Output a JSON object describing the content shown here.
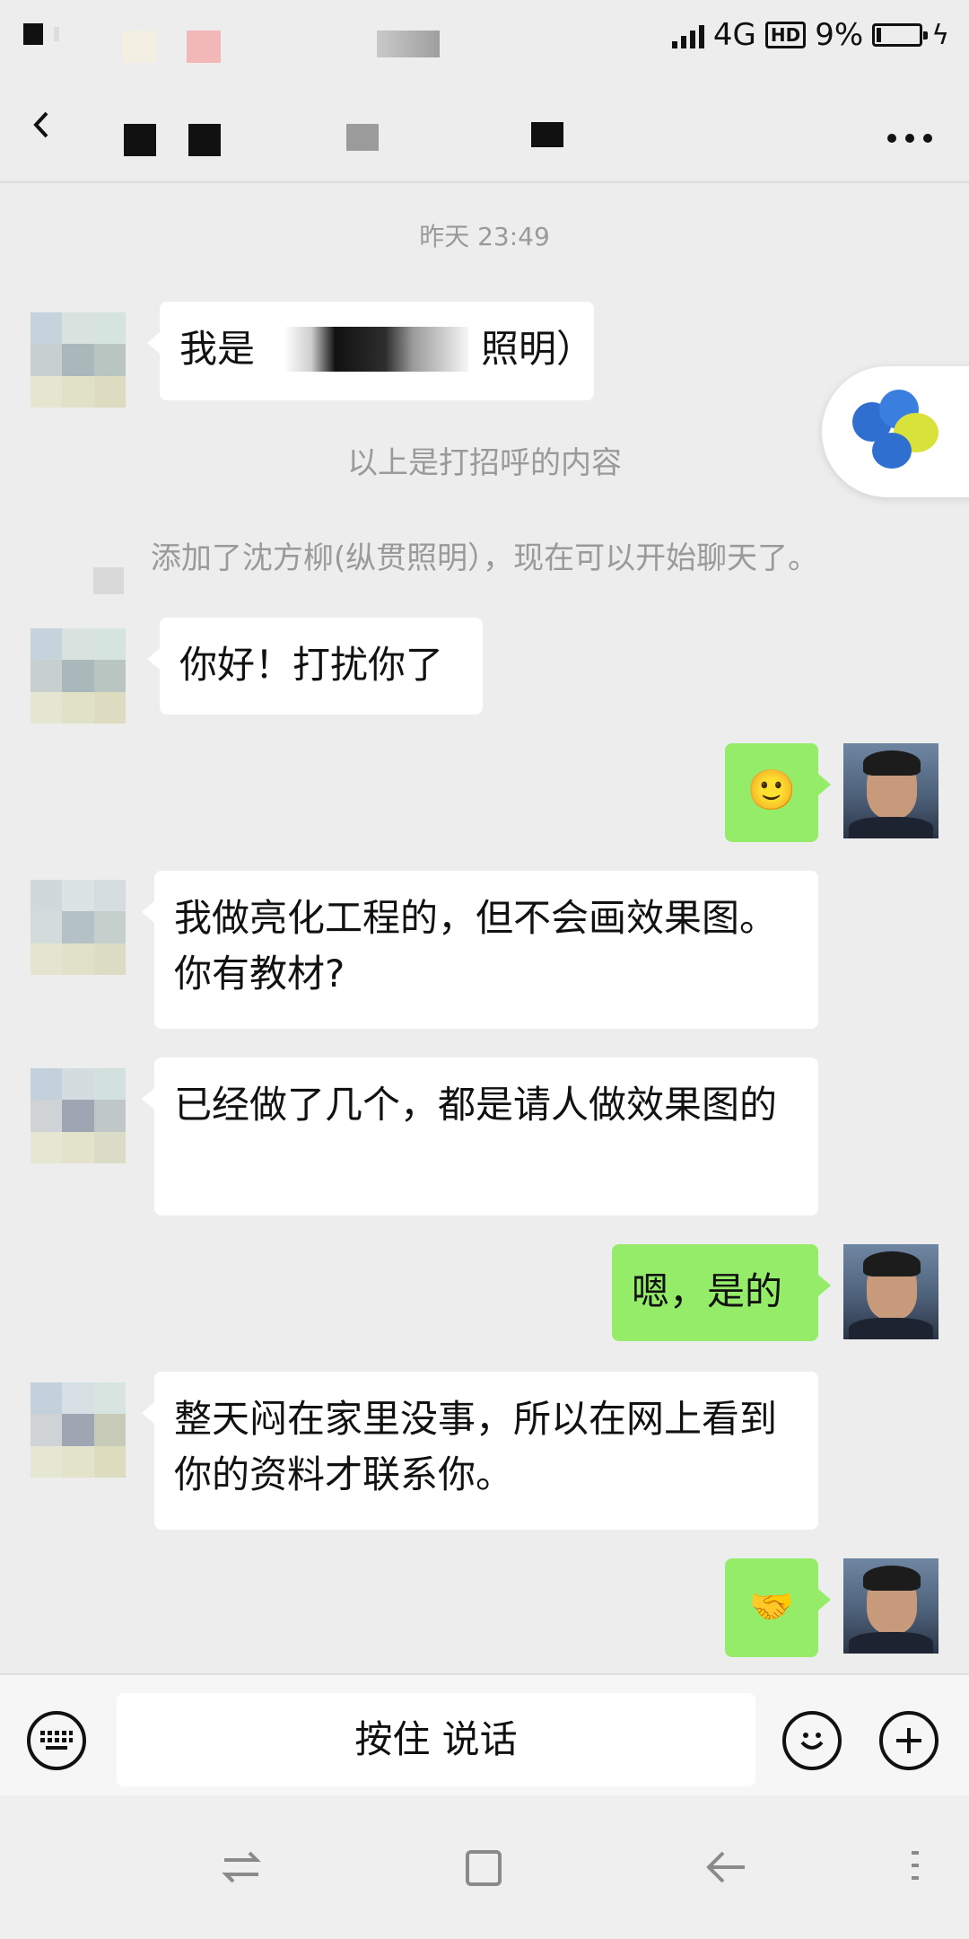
{
  "status_bar": {
    "network": "4G",
    "hd": "HD",
    "battery": "9%",
    "battery_level": 0.09
  },
  "chat": {
    "timestamp": "昨天 23:49",
    "messages": [
      {
        "side": "left",
        "type": "text",
        "text": "我是　　　　　　照明）"
      },
      {
        "side": "system",
        "text": "以上是打招呼的内容"
      },
      {
        "side": "system",
        "text": "添加了沈方柳(纵贯照明），现在可以开始聊天了。"
      },
      {
        "side": "left",
        "type": "text",
        "text": "你好！打扰你了"
      },
      {
        "side": "right",
        "type": "emoji",
        "emoji": "smile-emoji",
        "glyph": "🙂"
      },
      {
        "side": "left",
        "type": "text",
        "text": "我做亮化工程的，但不会画效果图。你有教材?"
      },
      {
        "side": "left",
        "type": "text",
        "text": "已经做了几个，都是请人做效果图的"
      },
      {
        "side": "right",
        "type": "text",
        "text": "嗯，是的"
      },
      {
        "side": "left",
        "type": "text",
        "text": "整天闷在家里没事，所以在网上看到你的资料才联系你。"
      },
      {
        "side": "right",
        "type": "emoji",
        "emoji": "handshake-emoji",
        "glyph": "🤝"
      }
    ]
  },
  "input_bar": {
    "hold_to_talk": "按住 说话"
  },
  "icons": {
    "back": "back-arrow-icon",
    "more": "more-options-icon",
    "keyboard": "keyboard-icon",
    "emoji": "emoji-icon",
    "add": "add-icon"
  },
  "colors": {
    "background": "#ededed",
    "my_bubble": "#95ec69",
    "their_bubble": "#ffffff",
    "system_text": "#9a9a9a"
  }
}
